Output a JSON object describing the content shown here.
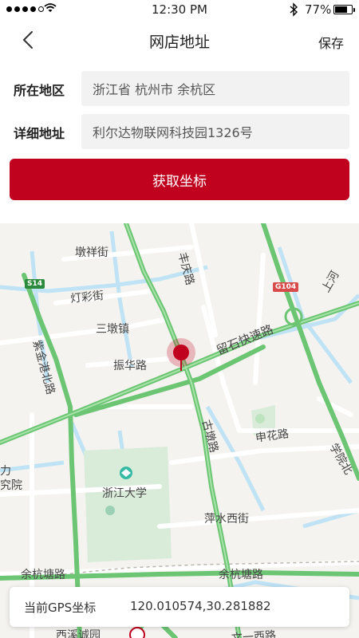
{
  "status_bar": {
    "time": "12:30 PM",
    "battery": "77%"
  },
  "nav": {
    "title": "网店地址",
    "save_label": "保存"
  },
  "form": {
    "region_label": "所在地区",
    "region_value": "浙江省 杭州市 余杭区",
    "detail_label": "详细地址",
    "detail_value": "利尔达物联网科技园1326号"
  },
  "button": {
    "get_coords_label": "获取坐标"
  },
  "map": {
    "labels": {
      "dunxiang": "墩祥街",
      "fengqing": "丰庆路",
      "dengcai": "灯彩街",
      "sandun": "三墩镇",
      "zijingang": "紫金港北路",
      "zhenhua": "振华路",
      "liushi": "留石快速路",
      "gudun": "古墩路",
      "shenhua": "申花路",
      "xueyuan": "学院北",
      "li": "力",
      "jiuyuan": "究院",
      "zju": "浙江大学",
      "pingshui": "萍水西街",
      "yuhang_tang": "余杭塘路",
      "yuhang_tang2": "余杭塘路",
      "xixi": "西溪诚园",
      "wenyi": "文一西路",
      "shanghe": "上河"
    },
    "shields": {
      "s14": "S14",
      "g104": "G104"
    }
  },
  "gps": {
    "label": "当前GPS坐标",
    "value": "120.010574,30.281882"
  },
  "colors": {
    "accent": "#c0021e",
    "road_green": "#7bd17d",
    "water": "#bfe3f5"
  }
}
